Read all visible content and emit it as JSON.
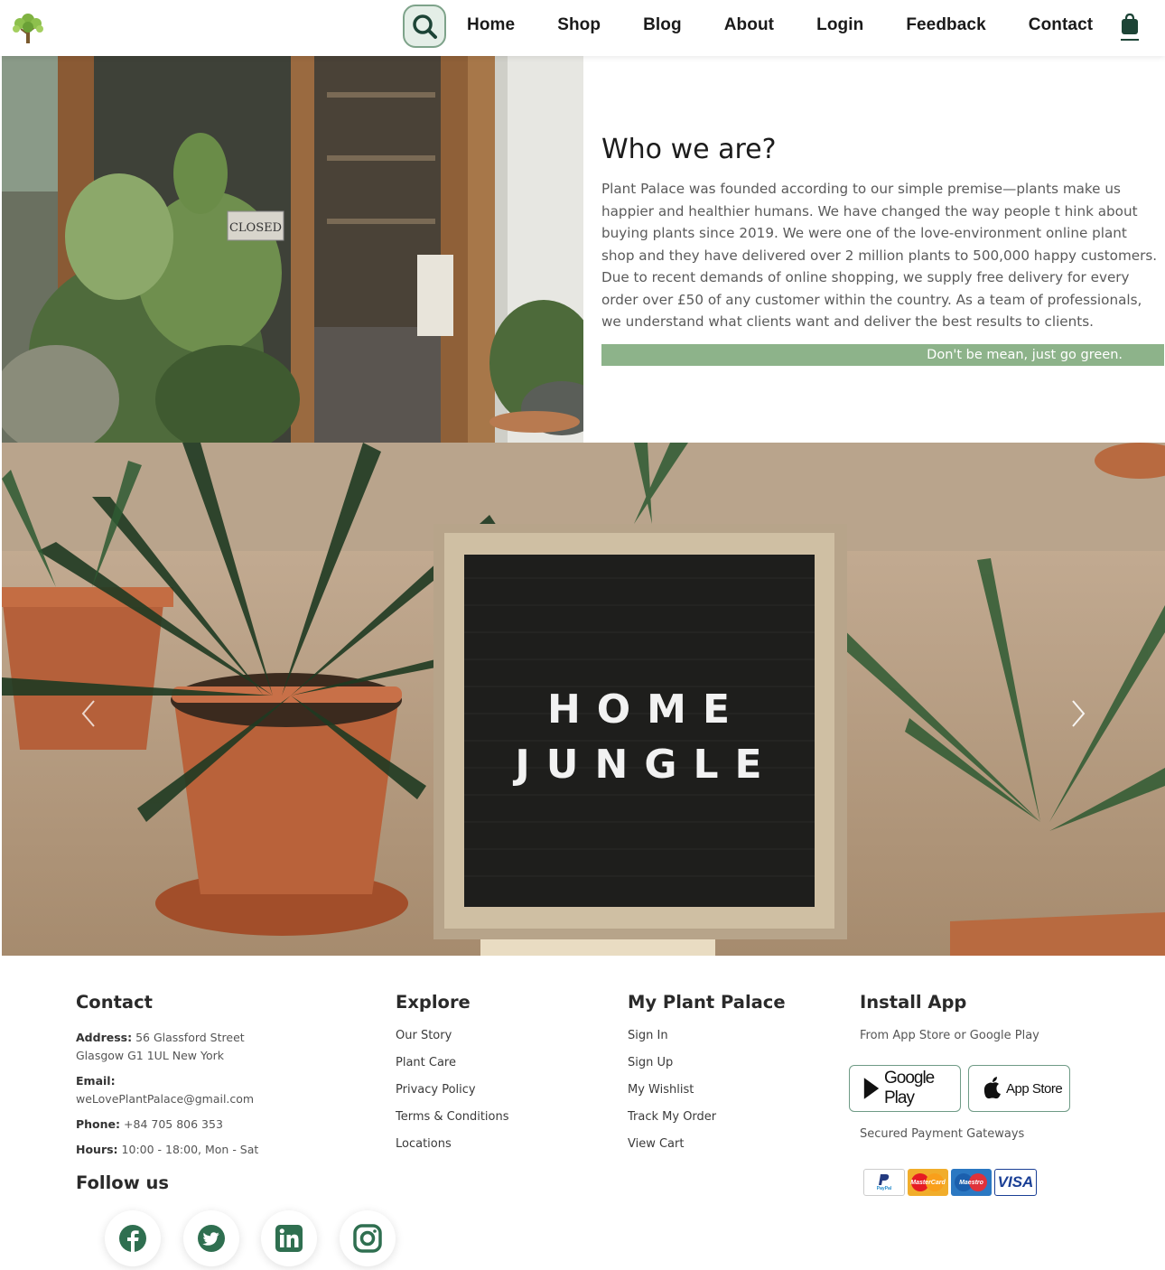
{
  "header": {
    "nav": [
      "Home",
      "Shop",
      "Blog",
      "About",
      "Login",
      "Feedback",
      "Contact"
    ]
  },
  "about": {
    "title": "Who we are?",
    "paragraph": "Plant Palace was founded according to our simple premise—plants make us happier and healthier humans. We have changed the way people t hink about buying plants since 2019. We were one of the love-environment online plant shop and they have delivered over 2 million plants to 500,000 happy customers. Due to recent demands of online shopping, we supply free delivery for every order over £50 of any customer within the country. As a team of professionals, we understand what clients want and deliver the best results to clients.",
    "slogan": "Don't be mean, just go green.",
    "photo_sign": "CLOSED"
  },
  "hero": {
    "board_line1": "HOME",
    "board_line2": "JUNGLE"
  },
  "footer": {
    "contact": {
      "heading": "Contact",
      "address_label": "Address:",
      "address": "56 Glassford Street Glasgow G1 1UL New York",
      "email_label": "Email:",
      "email": "weLovePlantPalace@gmail.com",
      "phone_label": "Phone:",
      "phone": "+84 705 806 353",
      "hours_label": "Hours:",
      "hours": "10:00 - 18:00, Mon - Sat"
    },
    "follow_heading": "Follow us",
    "explore": {
      "heading": "Explore",
      "links": [
        "Our Story",
        "Plant Care",
        "Privacy Policy",
        "Terms & Conditions",
        "Locations"
      ]
    },
    "my_plant_palace": {
      "heading": "My Plant Palace",
      "links": [
        "Sign In",
        "Sign Up",
        "My Wishlist",
        "Track My Order",
        "View Cart"
      ]
    },
    "install": {
      "heading": "Install App",
      "subtitle": "From App Store or Google Play",
      "google_play": "Google Play",
      "app_store": "App Store",
      "payment_label": "Secured Payment Gateways",
      "payments": [
        "PayPal",
        "MasterCard",
        "Maestro",
        "VISA"
      ]
    }
  },
  "colors": {
    "accent": "#8db38a",
    "social_icon": "#2f6f50",
    "search_bg": "#e4eee7"
  }
}
